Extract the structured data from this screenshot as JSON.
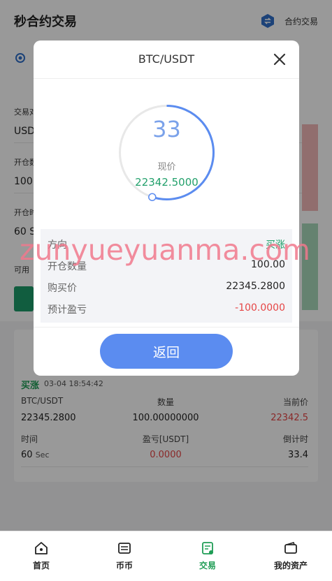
{
  "header": {
    "title": "秒合约交易",
    "link": "合约交易"
  },
  "background_form": {
    "fields": [
      {
        "label": "交易对",
        "value": "USD"
      },
      {
        "label": "开仓数量",
        "value": "100"
      },
      {
        "label": "开仓时间",
        "value": "60 S"
      },
      {
        "label": "可用",
        "value": "可用"
      }
    ]
  },
  "modal": {
    "title": "BTC/USDT",
    "countdown": "33",
    "countdown_fraction": 0.55,
    "price_label": "现价",
    "price_value": "22342.5000",
    "rows": [
      {
        "label": "方向",
        "value": "买涨"
      },
      {
        "label": "开仓数量",
        "value": "100.00"
      },
      {
        "label": "购买价",
        "value": "22345.2800"
      },
      {
        "label": "预计盈亏",
        "value": "-100.0000"
      }
    ],
    "back_label": "返回"
  },
  "order": {
    "direction": "买涨",
    "time": "03-04 18:54:42",
    "headers1": [
      "BTC/USDT",
      "数量",
      "当前价"
    ],
    "values1": [
      "22345.2800",
      "100.00000000",
      "22342.5"
    ],
    "headers2": [
      "时间",
      "盈亏[USDT]",
      "倒计时"
    ],
    "time_value": "60",
    "time_unit": "Sec",
    "pnl": "0.0000",
    "countdown": "33.4"
  },
  "tabs": [
    {
      "label": "首页",
      "icon": "home-icon"
    },
    {
      "label": "币币",
      "icon": "exchange-icon"
    },
    {
      "label": "交易",
      "icon": "trade-icon"
    },
    {
      "label": "我的资产",
      "icon": "wallet-icon"
    }
  ],
  "watermark": "zunyueyuanma.com",
  "colors": {
    "accent_blue": "#5b8cf0",
    "up_green": "#1f9d55",
    "down_red": "#e64545"
  }
}
